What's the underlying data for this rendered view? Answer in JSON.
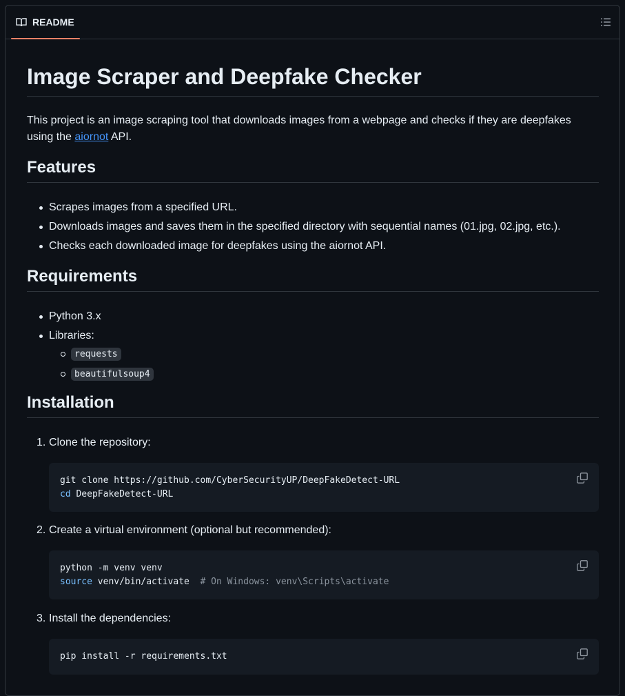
{
  "tab": {
    "label": "README"
  },
  "title": "Image Scraper and Deepfake Checker",
  "intro": {
    "before": "This project is an image scraping tool that downloads images from a webpage and checks if they are deepfakes using the ",
    "link": "aiornot",
    "after": " API."
  },
  "features": {
    "heading": "Features",
    "items": [
      "Scrapes images from a specified URL.",
      "Downloads images and saves them in the specified directory with sequential names (01.jpg, 02.jpg, etc.).",
      "Checks each downloaded image for deepfakes using the aiornot API."
    ]
  },
  "requirements": {
    "heading": "Requirements",
    "items": [
      "Python 3.x",
      "Libraries:"
    ],
    "libraries": [
      "requests",
      "beautifulsoup4"
    ]
  },
  "installation": {
    "heading": "Installation",
    "steps": [
      {
        "num": "1.",
        "text": "Clone the repository:",
        "code": [
          [
            {
              "t": "git clone https://github.com/CyberSecurityUP/DeepFakeDetect-URL",
              "c": ""
            }
          ],
          [
            {
              "t": "cd",
              "c": "kw"
            },
            {
              "t": " DeepFakeDetect-URL",
              "c": ""
            }
          ]
        ]
      },
      {
        "num": "2.",
        "text": "Create a virtual environment (optional but recommended):",
        "code": [
          [
            {
              "t": "python -m venv venv",
              "c": ""
            }
          ],
          [
            {
              "t": "source",
              "c": "kw"
            },
            {
              "t": " venv/bin/activate  ",
              "c": ""
            },
            {
              "t": "# On Windows: venv\\Scripts\\activate",
              "c": "cm"
            }
          ]
        ]
      },
      {
        "num": "3.",
        "text": "Install the dependencies:",
        "code": [
          [
            {
              "t": "pip install -r requirements.txt",
              "c": ""
            }
          ]
        ]
      }
    ]
  },
  "icons": {
    "tab": "book-icon",
    "toc": "list-icon",
    "copy": "copy-icon"
  },
  "colors": {
    "accent": "#f78166",
    "link": "#4493f8",
    "keyword": "#79c0ff",
    "comment": "#8b949e"
  }
}
